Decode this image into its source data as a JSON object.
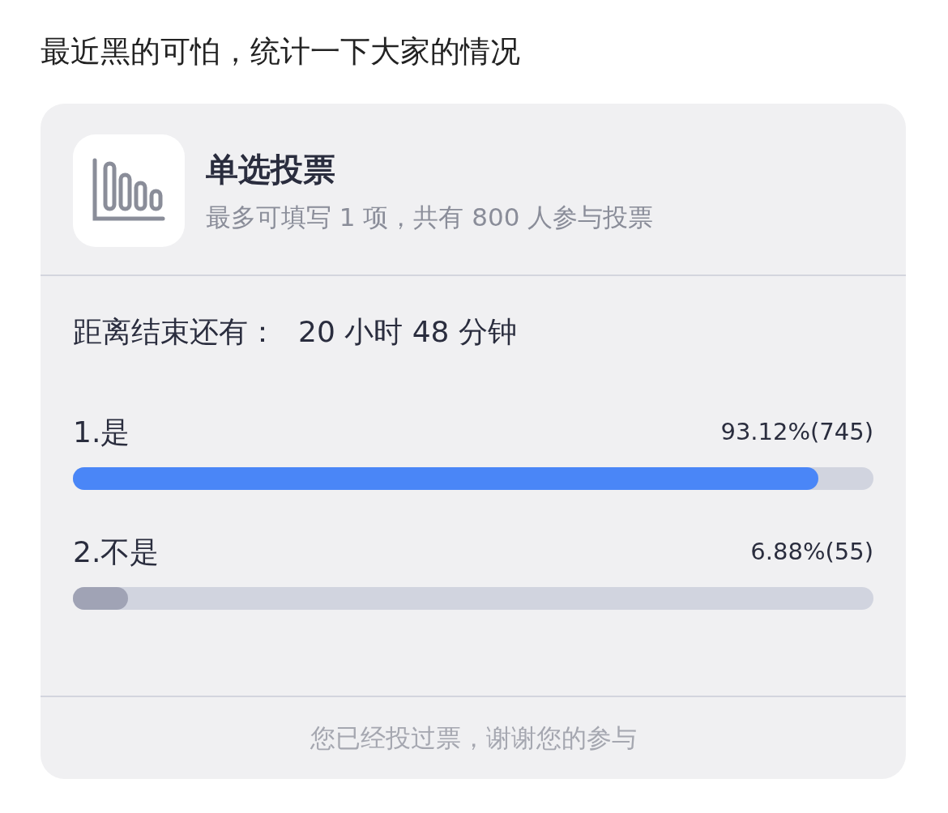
{
  "post_text": "最近黑的可怕，统计一下大家的情况",
  "poll": {
    "title": "单选投票",
    "subtitle": "最多可填写 1 项，共有 800 人参与投票",
    "countdown_label": "距离结束还有：",
    "countdown_value": "20 小时 48 分钟",
    "options": [
      {
        "label": "1.是",
        "result": "93.12%(745)",
        "level": 0.9312,
        "selected": true
      },
      {
        "label": "2.不是",
        "result": "6.88%(55)",
        "level": 0.0688,
        "selected": false
      }
    ],
    "footer": "您已经投过票，谢谢您的参与"
  }
}
